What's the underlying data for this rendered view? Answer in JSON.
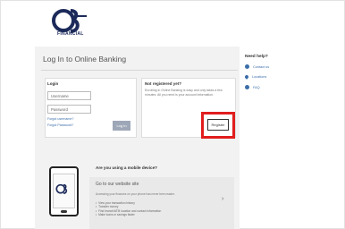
{
  "brand": {
    "logo_text": "FINANCIAL"
  },
  "page": {
    "title": "Log In to Online Banking"
  },
  "login": {
    "label": "Login",
    "username_value": "Username",
    "password_value": "Password",
    "forgot_username": "Forgot username?",
    "forgot_password": "Forgot Password?",
    "login_button": "Log In"
  },
  "register": {
    "title": "Not registered yet?",
    "description": "Enrolling in Online Banking is easy and only takes a few minutes. All you need is your account information.",
    "button": "Register"
  },
  "help": {
    "title": "Need help?",
    "items": [
      "Contact us",
      "Locations",
      "FAQ"
    ]
  },
  "mobile": {
    "question": "Are you using a mobile device?",
    "panel_title": "Go to our website site",
    "description": "Accessing your finances on your phone has never been easier.",
    "bullets": [
      "View your transaction history",
      "Transfer money",
      "Find branch/ATM location and contact information",
      "Make loans or savings faster"
    ]
  },
  "colors": {
    "accent": "#3b6ea8",
    "highlight": "#e11d1d",
    "brand_navy": "#1c2a5a"
  }
}
